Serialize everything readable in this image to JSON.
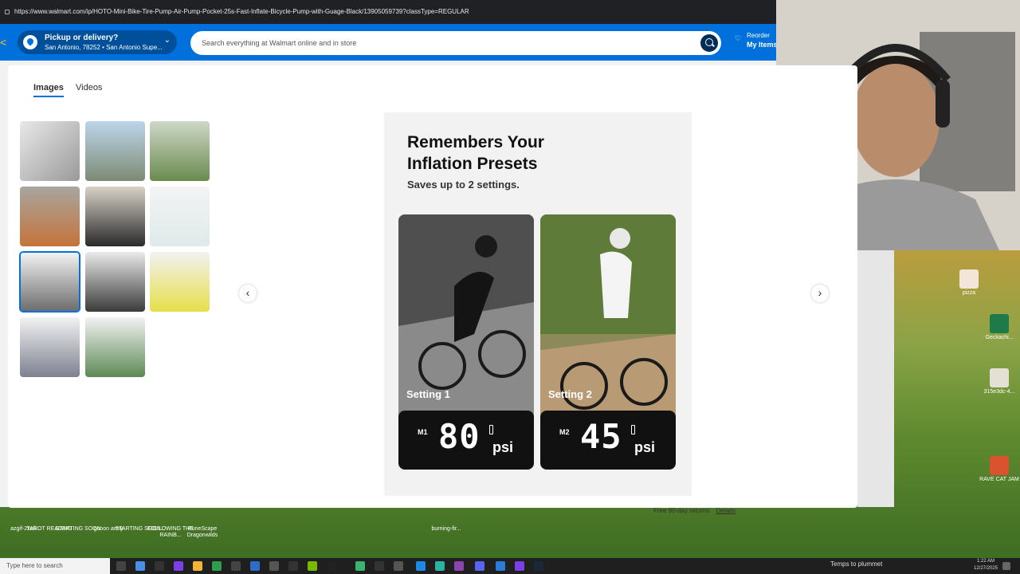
{
  "browser": {
    "url": "https://www.walmart.com/ip/HOTO-Mini-Bike-Tire-Pump-Air-Pump-Pocket-25s-Fast-Inflate-Bicycle-Pump-with-Guage-Black/13905059739?classType=REGULAR"
  },
  "header": {
    "pickup_title": "Pickup or delivery?",
    "pickup_location": "San Antonio, 78252 • San Antonio Supe...",
    "search_placeholder": "Search everything at Walmart online and in store",
    "reorder_label": "Reorder",
    "my_items_label": "My Items"
  },
  "modal": {
    "tabs": [
      {
        "label": "Images"
      },
      {
        "label": "Videos"
      }
    ],
    "active_tab": "Images",
    "thumbnail_count": 11,
    "selected_thumbnail_index": 6
  },
  "main_image": {
    "title_line1": "Remembers Your",
    "title_line2": "Inflation Presets",
    "subtitle": "Saves up to 2 settings.",
    "settings": [
      {
        "label": "Setting 1",
        "mode": "M1",
        "value": "80",
        "unit": "psi"
      },
      {
        "label": "Setting 2",
        "mode": "M2",
        "value": "45",
        "unit": "psi"
      }
    ]
  },
  "page_below": {
    "returns_text": "Free 90-day returns",
    "details_link": "Details"
  },
  "desktop_icons": [
    {
      "label": "RAVE CAT JAM"
    },
    {
      "label": "pizza"
    },
    {
      "label": "Geckachi..."
    },
    {
      "label": "315e3dc-4..."
    }
  ],
  "taskbar": {
    "search_placeholder": "Type here to search",
    "weather": "Temps to plummet",
    "time": "1:22 AM",
    "date": "12/27/2025"
  },
  "bottom_shortcuts": [
    "azgif-2xefi...",
    "TAROT READING",
    "STARTING SOON",
    "gooon army",
    "STARTING SOON...",
    "FOLLOWING THE RAINB...",
    "RuneScape Dragonwilds",
    "burning-fir..."
  ],
  "colors": {
    "walmart_blue": "#0071dc",
    "walmart_yellow": "#ffc220",
    "dark_navy": "#002d58"
  }
}
